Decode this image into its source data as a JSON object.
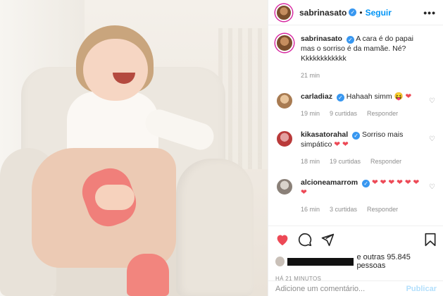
{
  "header": {
    "username": "sabrinasato",
    "verified": true,
    "dot": "•",
    "follow_label": "Seguir",
    "more_icon": "more-icon"
  },
  "caption": {
    "username": "sabrinasato",
    "text": "A cara é do papai mas o sorriso é da mamãe. Né? Kkkkkkkkkkkk",
    "time": "21 min"
  },
  "comments": [
    {
      "username": "carladiaz",
      "text": "Hahaah simm 😝",
      "hearts": "❤",
      "time": "19 min",
      "likes": "9 curtidas",
      "reply": "Responder"
    },
    {
      "username": "kikasatorahal",
      "text": "Sorriso mais simpático",
      "hearts": "❤ ❤",
      "time": "18 min",
      "likes": "19 curtidas",
      "reply": "Responder"
    },
    {
      "username": "alcioneamarrom",
      "text": "",
      "hearts": "❤ ❤ ❤ ❤ ❤ ❤ ❤",
      "time": "16 min",
      "likes": "3 curtidas",
      "reply": "Responder"
    }
  ],
  "actions": {
    "like_icon": "heart-icon",
    "comment_icon": "comment-icon",
    "share_icon": "share-icon",
    "save_icon": "bookmark-icon",
    "likes_text": "e outras 95.845 pessoas",
    "posted": "HÁ 21 MINUTOS"
  },
  "add_comment": {
    "placeholder": "Adicione um comentário...",
    "publish_label": "Publicar"
  },
  "colors": {
    "accent": "#0095f6",
    "like_red": "#ed4956",
    "verified": "#3897f0"
  }
}
